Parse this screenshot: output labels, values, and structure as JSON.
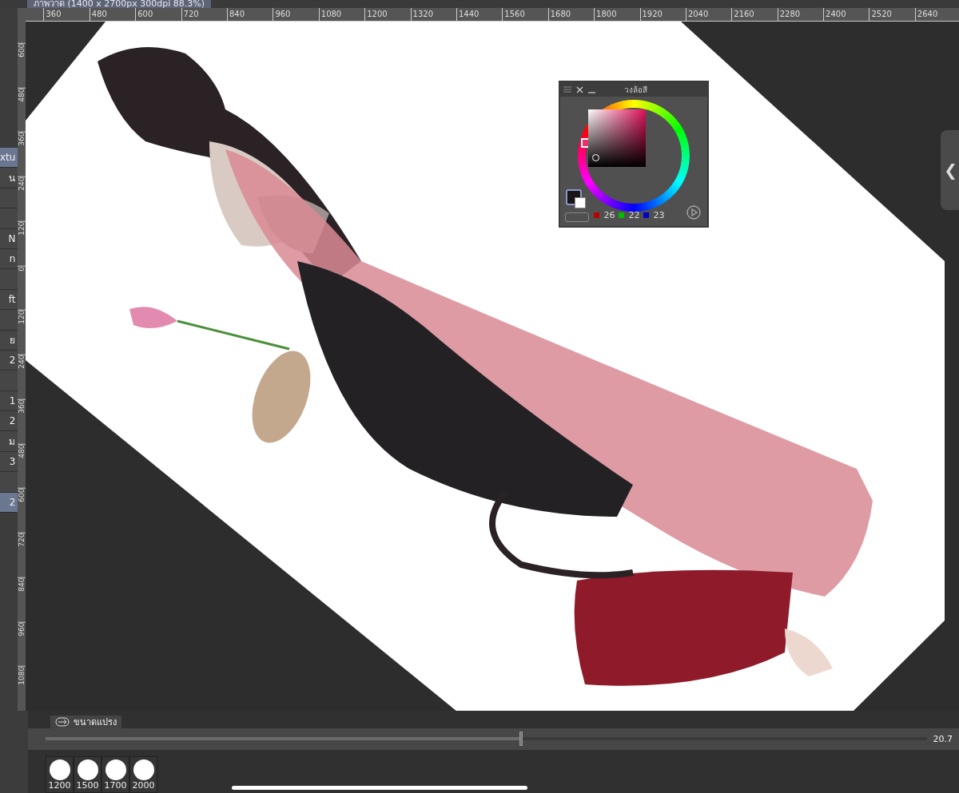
{
  "document_tab": {
    "title": "ภาพวาด (1400 x 2700px 300dpi 88.3%)"
  },
  "top_ruler": [
    "360",
    "480",
    "600",
    "720",
    "840",
    "960",
    "1080",
    "1200",
    "1320",
    "1440",
    "1560",
    "1680",
    "1800",
    "1920",
    "2040",
    "2160",
    "2280",
    "2400",
    "2520",
    "2640"
  ],
  "side_ruler": [
    "600",
    "480",
    "360",
    "240",
    "120",
    "0",
    "120",
    "240",
    "360",
    "480",
    "600",
    "720",
    "840",
    "960",
    "1080"
  ],
  "layers": [
    {
      "label": "xtu",
      "selected": true
    },
    {
      "label": "น",
      "selected": false
    },
    {
      "selected": false
    },
    {
      "selected": false
    },
    {
      "label": "N",
      "selected": false
    },
    {
      "label": "n",
      "selected": false
    },
    {
      "selected": false
    },
    {
      "label": "ft",
      "selected": false
    },
    {
      "selected": false
    },
    {
      "label": "ย",
      "selected": false
    },
    {
      "label": "2",
      "selected": false
    },
    {
      "selected": false
    },
    {
      "label": "1",
      "selected": false
    },
    {
      "label": "2",
      "selected": false
    },
    {
      "label": "ม",
      "selected": false
    },
    {
      "label": "3",
      "selected": false
    },
    {
      "selected": false
    },
    {
      "label": "2",
      "selected": true
    }
  ],
  "panel_toggle": {
    "label": "❮"
  },
  "color_wheel": {
    "title": "วงล้อสี",
    "r": "26",
    "g": "22",
    "b": "23"
  },
  "brush_size": {
    "tab": "ขนาดแปรง",
    "level": 0.54,
    "value": "20.7",
    "presets": [
      "1200",
      "1500",
      "1700",
      "2000"
    ]
  }
}
